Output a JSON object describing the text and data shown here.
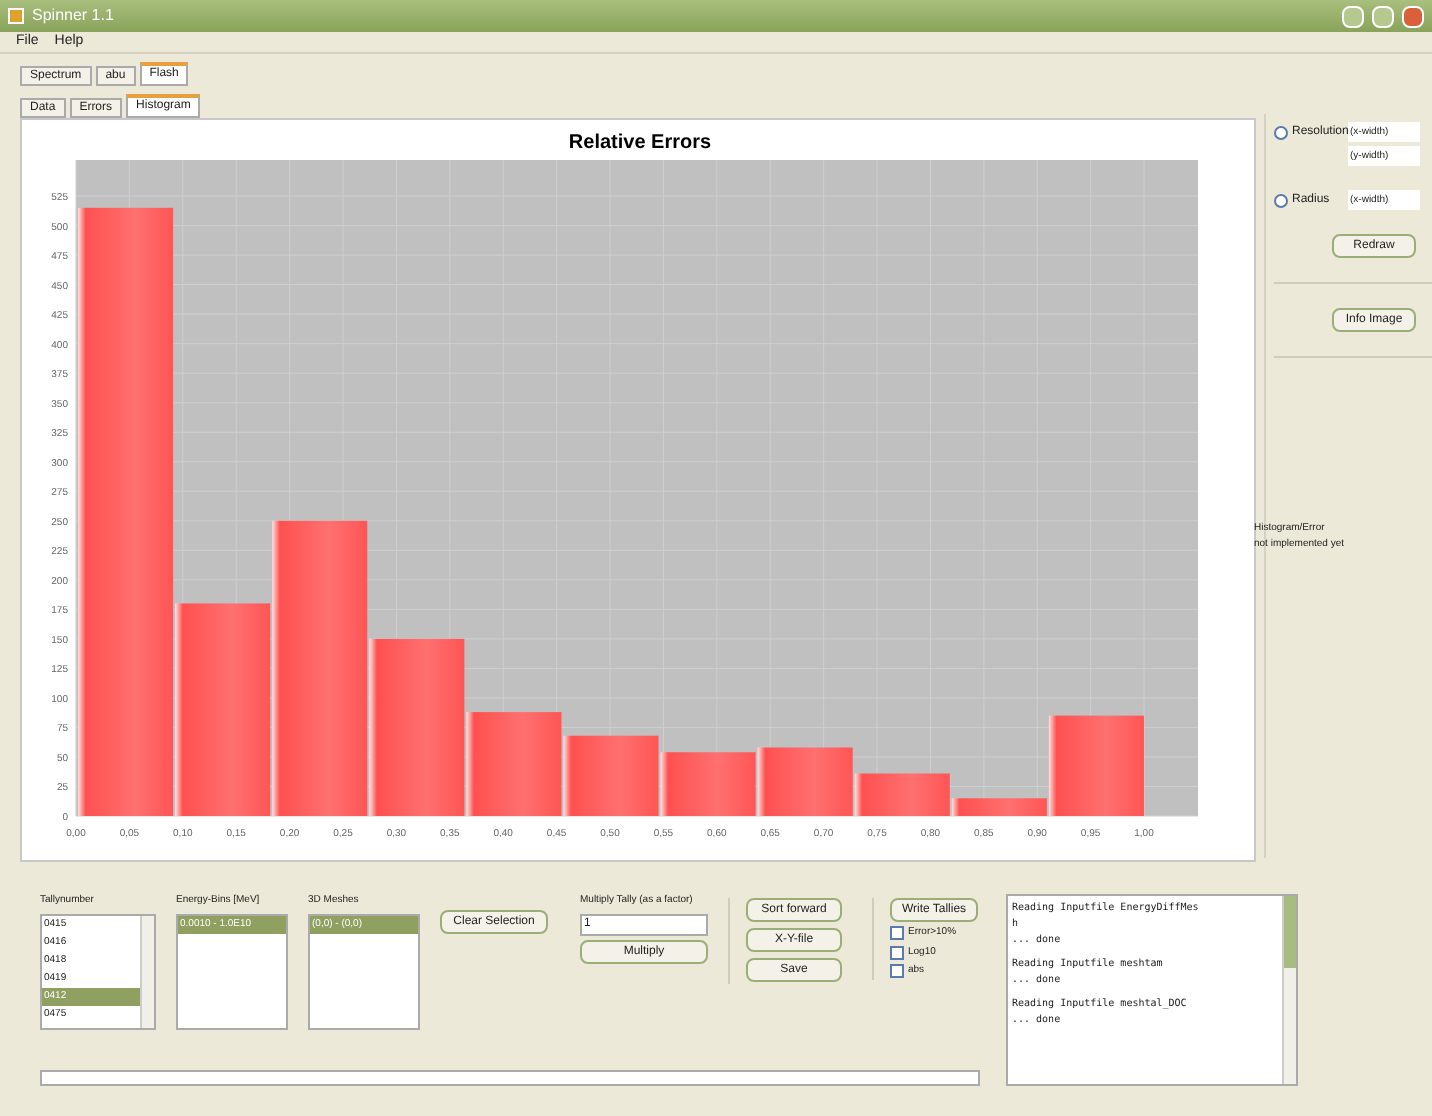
{
  "window": {
    "title": "Spinner 1.1"
  },
  "menu": [
    "File",
    "Help"
  ],
  "tabs": [
    {
      "label": "Spectrum",
      "selected": false
    },
    {
      "label": "abu",
      "selected": false
    },
    {
      "label": "Flash",
      "selected": true
    }
  ],
  "subtabs": [
    {
      "label": "Data",
      "selected": false
    },
    {
      "label": "Errors",
      "selected": false
    },
    {
      "label": "Histogram",
      "selected": true
    }
  ],
  "chart": {
    "chart_data": {
      "type": "bar",
      "title": "Relative Errors",
      "x": [
        0.0455,
        0.1364,
        0.2273,
        0.3182,
        0.4091,
        0.5,
        0.5909,
        0.6818,
        0.7727,
        0.8636,
        0.9545
      ],
      "values": [
        515,
        180,
        250,
        150,
        88,
        68,
        54,
        58,
        36,
        15,
        85
      ],
      "xlim": [
        0,
        1
      ],
      "grid": true,
      "ylim": [
        0,
        525
      ],
      "xticks": [
        {
          "value": 0,
          "label": "0,00"
        },
        {
          "value": 0.05,
          "label": "0,05"
        },
        {
          "value": 0.1,
          "label": "0,10"
        },
        {
          "value": 0.15,
          "label": "0,15"
        },
        {
          "value": 0.2,
          "label": "0,20"
        },
        {
          "value": 0.25,
          "label": "0,25"
        },
        {
          "value": 0.3,
          "label": "0,30"
        },
        {
          "value": 0.35,
          "label": "0,35"
        },
        {
          "value": 0.4,
          "label": "0,40"
        },
        {
          "value": 0.45,
          "label": "0,45"
        },
        {
          "value": 0.5,
          "label": "0,50"
        },
        {
          "value": 0.55,
          "label": "0,55"
        },
        {
          "value": 0.6,
          "label": "0,60"
        },
        {
          "value": 0.65,
          "label": "0,65"
        },
        {
          "value": 0.7,
          "label": "0,70"
        },
        {
          "value": 0.75,
          "label": "0,75"
        },
        {
          "value": 0.8,
          "label": "0,80"
        },
        {
          "value": 0.85,
          "label": "0,85"
        },
        {
          "value": 0.9,
          "label": "0,90"
        },
        {
          "value": 0.95,
          "label": "0,95"
        },
        {
          "value": 1,
          "label": "1,00"
        }
      ],
      "yticks": [
        0,
        25,
        50,
        75,
        100,
        125,
        150,
        175,
        200,
        225,
        250,
        275,
        300,
        325,
        350,
        375,
        400,
        425,
        450,
        475,
        500,
        525
      ]
    }
  },
  "side": {
    "options": [
      {
        "label": "Resolution",
        "selected": false,
        "fields": [
          "(x-width)",
          "(y-width)"
        ]
      },
      {
        "label": "Radius",
        "selected": false,
        "fields": [
          "(x-width)"
        ]
      }
    ],
    "redraw": "Redraw",
    "info": "Info Image",
    "note": [
      "Histogram/Error",
      "not implemented yet"
    ]
  },
  "bottom": {
    "tally_label": "Tallynumber",
    "tallies": [
      {
        "label": "0415",
        "selected": false
      },
      {
        "label": "0416",
        "selected": false
      },
      {
        "label": "0418",
        "selected": false
      },
      {
        "label": "0419",
        "selected": false
      },
      {
        "label": "0412",
        "selected": true
      },
      {
        "label": "0475",
        "selected": false
      }
    ],
    "energy_label": "Energy-Bins [MeV]",
    "energy": [
      {
        "label": "0.0010 - 1.0E10",
        "selected": true
      }
    ],
    "mesh_label": "3D Meshes",
    "meshes": [
      {
        "label": "(0,0) - (0,0)",
        "selected": true
      }
    ],
    "clear": "Clear Selection",
    "multiply_label": "Multiply Tally (as a factor)",
    "factor": "1",
    "multiply": "Multiply",
    "actions": [
      "Sort forward",
      "X-Y-file",
      "Save"
    ],
    "write": "Write Tallies",
    "progress": {
      "level": 0
    },
    "checks": [
      {
        "label": "Error>10%",
        "checked": false
      },
      {
        "label": "Log10",
        "checked": false
      },
      {
        "label": "abs",
        "checked": false
      }
    ],
    "log": [
      [
        "Reading Inputfile EnergyDiffMes",
        "h",
        "... done"
      ],
      [
        "Reading Inputfile meshtam",
        "... done"
      ],
      [
        "Reading Inputfile meshtal_DOC",
        "... done"
      ]
    ]
  }
}
